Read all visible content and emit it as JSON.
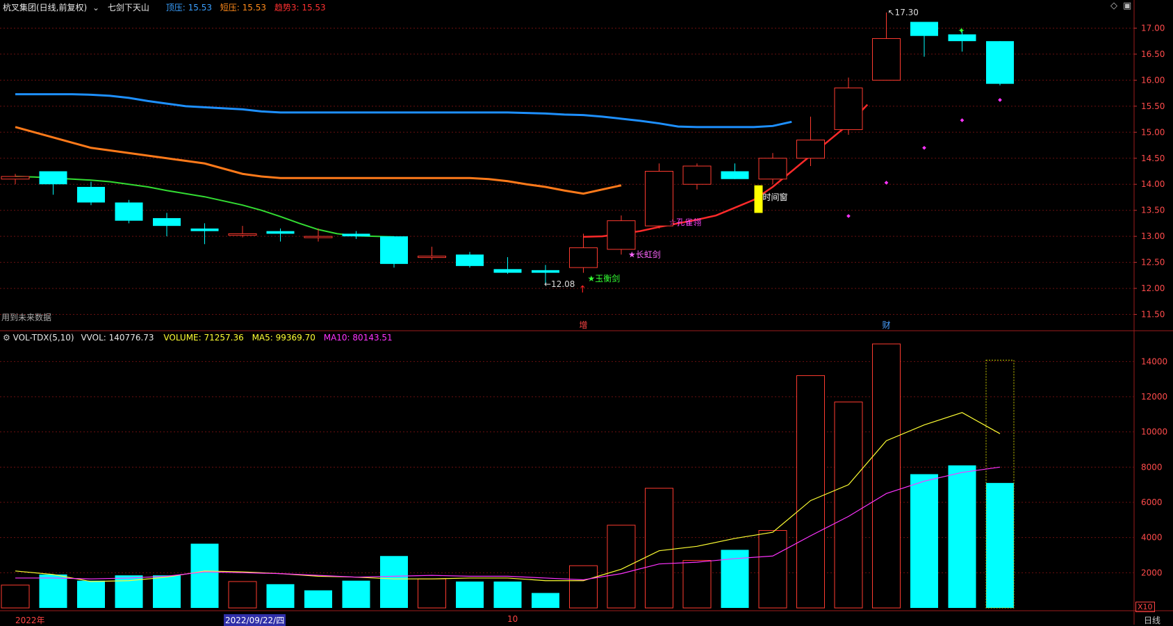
{
  "header": {
    "title": "杭叉集团(日线,前复权)",
    "formula": "七剑下天山",
    "ind1_label": "顶压: 15.53",
    "ind2_label": "短压: 15.53",
    "ind3_label": "趋势3: 15.53",
    "note": "用到未来数据",
    "max_label": "17.30",
    "min_label": "12.08",
    "tags": [
      "增",
      "财"
    ]
  },
  "vol_header": {
    "name": "VOL-TDX(5,10)",
    "vvol": "VVOL: 140776.73",
    "volume": "VOLUME: 71257.36",
    "ma5": "MA5: 99369.70",
    "ma10": "MA10: 80143.51",
    "unit": "X10"
  },
  "bottom": {
    "year": "2022年",
    "date": "2022/09/22/四",
    "month": "10",
    "period": "日线"
  },
  "signals": [
    "★玉衡剑",
    "★长虹剑",
    "☆孔雀翎",
    "时间窗"
  ],
  "colors": {
    "up": "#ff3b30",
    "down": "#00ffff",
    "ma_blue": "#1e90ff",
    "ma_orange": "#ff7a1a",
    "ma_green": "#33dd33",
    "trend_red": "#ff2a2a"
  },
  "chart_data": [
    {
      "type": "candlestick",
      "ylim": [
        11.2,
        17.3
      ],
      "yticks": [
        11.5,
        12.0,
        12.5,
        13.0,
        13.5,
        14.0,
        14.5,
        15.0,
        15.5,
        16.0,
        16.5,
        17.0
      ],
      "candles": [
        {
          "o": 14.1,
          "h": 14.2,
          "l": 14.0,
          "c": 14.15
        },
        {
          "o": 14.25,
          "h": 14.25,
          "l": 13.8,
          "c": 14.0
        },
        {
          "o": 13.95,
          "h": 14.05,
          "l": 13.6,
          "c": 13.65
        },
        {
          "o": 13.65,
          "h": 13.7,
          "l": 13.25,
          "c": 13.3
        },
        {
          "o": 13.35,
          "h": 13.45,
          "l": 13.0,
          "c": 13.2
        },
        {
          "o": 13.15,
          "h": 13.25,
          "l": 12.85,
          "c": 13.1
        },
        {
          "o": 13.02,
          "h": 13.2,
          "l": 12.98,
          "c": 13.05
        },
        {
          "o": 13.1,
          "h": 13.15,
          "l": 12.9,
          "c": 13.05
        },
        {
          "o": 13.0,
          "h": 13.15,
          "l": 12.9,
          "c": 13.0
        },
        {
          "o": 13.05,
          "h": 13.1,
          "l": 12.95,
          "c": 13.0
        },
        {
          "o": 13.0,
          "h": 13.0,
          "l": 12.4,
          "c": 12.47
        },
        {
          "o": 12.6,
          "h": 12.8,
          "l": 12.55,
          "c": 12.62
        },
        {
          "o": 12.65,
          "h": 12.7,
          "l": 12.4,
          "c": 12.43
        },
        {
          "o": 12.37,
          "h": 12.6,
          "l": 12.28,
          "c": 12.3
        },
        {
          "o": 12.35,
          "h": 12.45,
          "l": 12.08,
          "c": 12.3
        },
        {
          "o": 12.4,
          "h": 13.05,
          "l": 12.3,
          "c": 12.78
        },
        {
          "o": 12.75,
          "h": 13.4,
          "l": 12.65,
          "c": 13.3
        },
        {
          "o": 13.2,
          "h": 14.4,
          "l": 13.15,
          "c": 14.25
        },
        {
          "o": 14.0,
          "h": 14.4,
          "l": 13.9,
          "c": 14.35
        },
        {
          "o": 14.25,
          "h": 14.4,
          "l": 14.1,
          "c": 14.1
        },
        {
          "o": 14.1,
          "h": 14.6,
          "l": 14.0,
          "c": 14.5
        },
        {
          "o": 14.5,
          "h": 15.3,
          "l": 14.35,
          "c": 14.85
        },
        {
          "o": 15.05,
          "h": 16.05,
          "l": 14.95,
          "c": 15.85
        },
        {
          "o": 16.0,
          "h": 17.3,
          "l": 16.0,
          "c": 16.8
        },
        {
          "o": 17.12,
          "h": 17.12,
          "l": 16.45,
          "c": 16.85
        },
        {
          "o": 16.88,
          "h": 16.95,
          "l": 16.55,
          "c": 16.75
        },
        {
          "o": 16.75,
          "h": 16.75,
          "l": 15.9,
          "c": 15.93
        }
      ],
      "lines": {
        "blue": [
          15.73,
          15.73,
          15.73,
          15.73,
          15.72,
          15.7,
          15.66,
          15.6,
          15.55,
          15.5,
          15.48,
          15.46,
          15.44,
          15.4,
          15.38,
          15.38,
          15.38,
          15.38,
          15.38,
          15.38,
          15.38,
          15.38,
          15.38,
          15.38,
          15.38,
          15.38,
          15.38,
          15.37,
          15.36,
          15.34,
          15.33,
          15.3,
          15.26,
          15.22,
          15.17,
          15.11,
          15.1,
          15.1,
          15.1,
          15.1,
          15.12,
          15.2
        ],
        "orange": [
          15.1,
          15.0,
          14.9,
          14.8,
          14.7,
          14.65,
          14.6,
          14.55,
          14.5,
          14.45,
          14.4,
          14.3,
          14.2,
          14.15,
          14.12,
          14.12,
          14.12,
          14.12,
          14.12,
          14.12,
          14.12,
          14.12,
          14.12,
          14.12,
          14.12,
          14.1,
          14.06,
          14.0,
          13.95,
          13.88,
          13.82,
          13.9,
          13.98
        ],
        "green": [
          14.15,
          14.14,
          14.12,
          14.1,
          14.08,
          14.05,
          14.0,
          13.95,
          13.88,
          13.82,
          13.76,
          13.68,
          13.6,
          13.5,
          13.38,
          13.25,
          13.13,
          13.05,
          13.01,
          13.0,
          12.99
        ],
        "trend": [
          12.99,
          13.0,
          13.05,
          13.1,
          13.18,
          13.25,
          13.32,
          13.4,
          13.55,
          13.7,
          13.95,
          14.25,
          14.55,
          14.85,
          15.15,
          15.53
        ],
        "dots": [
          13.39,
          14.03,
          14.7,
          15.23,
          15.62
        ]
      }
    },
    {
      "type": "bar",
      "ylim": [
        0,
        15000
      ],
      "yticks": [
        2000,
        4000,
        6000,
        8000,
        10000,
        12000,
        14000
      ],
      "values": [
        1300,
        1900,
        1550,
        1850,
        1850,
        3650,
        1500,
        1350,
        1000,
        1550,
        2950,
        1650,
        1500,
        1500,
        850,
        2400,
        4700,
        6800,
        2700,
        3300,
        4400,
        13200,
        11700,
        15000,
        7600,
        8100,
        7100
      ],
      "types": [
        "up",
        "down",
        "down",
        "down",
        "down",
        "down",
        "up",
        "down",
        "down",
        "down",
        "down",
        "up",
        "down",
        "down",
        "down",
        "up",
        "up",
        "up",
        "up",
        "down",
        "up",
        "up",
        "up",
        "up",
        "down",
        "down",
        "down"
      ],
      "ma5": [
        2100,
        1900,
        1500,
        1550,
        1750,
        2100,
        2050,
        1950,
        1800,
        1750,
        1650,
        1650,
        1700,
        1700,
        1550,
        1550,
        2200,
        3250,
        3500,
        3950,
        4300,
        6100,
        7000,
        9500,
        10400,
        11100,
        9900
      ],
      "ma10": [
        1700,
        1700,
        1650,
        1700,
        1800,
        2050,
        2000,
        1950,
        1850,
        1750,
        1800,
        1850,
        1800,
        1800,
        1700,
        1600,
        1950,
        2500,
        2600,
        2800,
        2950,
        4100,
        5200,
        6500,
        7200,
        7700,
        8000
      ]
    }
  ]
}
